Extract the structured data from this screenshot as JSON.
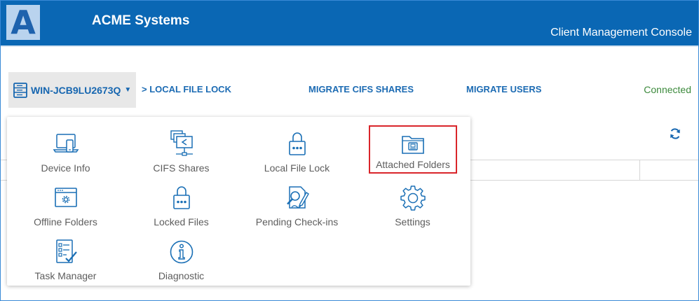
{
  "header": {
    "logo_letter": "A",
    "company": "ACME Systems",
    "console_title": "Client Management Console"
  },
  "toolbar": {
    "device_name": "WIN-JCB9LU2673Q",
    "breadcrumb": "> LOCAL FILE LOCK",
    "migrate_cifs": "MIGRATE CIFS SHARES",
    "migrate_users": "MIGRATE USERS",
    "status": "Connected"
  },
  "menu": {
    "items": [
      {
        "label": "Device Info",
        "icon": "device-info-icon"
      },
      {
        "label": "CIFS Shares",
        "icon": "cifs-shares-icon"
      },
      {
        "label": "Local File Lock",
        "icon": "lock-icon"
      },
      {
        "label": "Attached Folders",
        "icon": "attached-folder-icon",
        "selected": true
      },
      {
        "label": "Offline Folders",
        "icon": "offline-folder-icon"
      },
      {
        "label": "Locked Files",
        "icon": "locked-files-icon"
      },
      {
        "label": "Pending Check-ins",
        "icon": "pending-checkin-icon"
      },
      {
        "label": "Settings",
        "icon": "gear-icon"
      },
      {
        "label": "Task Manager",
        "icon": "task-manager-icon"
      },
      {
        "label": "Diagnostic",
        "icon": "info-icon"
      }
    ]
  },
  "colors": {
    "header_bg": "#0a67b4",
    "link": "#1c6bb3",
    "status": "#3c8a3c",
    "highlight": "#d9252a"
  }
}
